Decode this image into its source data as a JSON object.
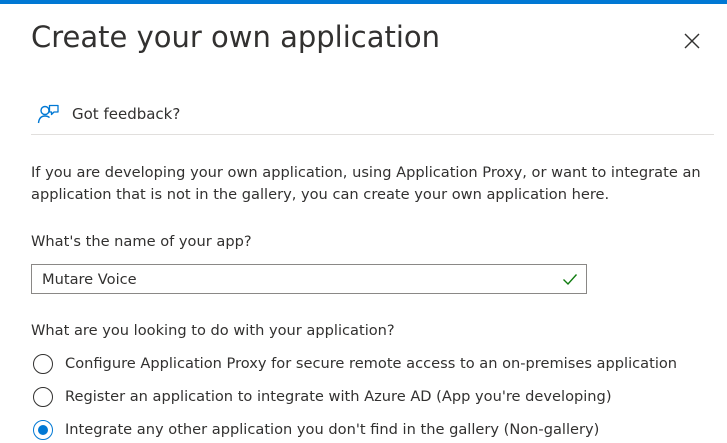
{
  "dialog": {
    "title": "Create your own application",
    "close_icon": "close-icon",
    "accent_color": "#0078d4"
  },
  "feedback": {
    "label": "Got feedback?",
    "icon": "feedback-icon"
  },
  "intro": {
    "text": "If you are developing your own application, using Application Proxy, or want to integrate an application that is not in the gallery, you can create your own application here."
  },
  "app_name": {
    "label": "What's the name of your app?",
    "value": "Mutare Voice",
    "status_icon": "checkmark-icon",
    "valid_color": "#107c10"
  },
  "purpose": {
    "question": "What are you looking to do with your application?",
    "options": [
      {
        "label": "Configure Application Proxy for secure remote access to an on-premises application",
        "selected": false
      },
      {
        "label": "Register an application to integrate with Azure AD (App you're developing)",
        "selected": false
      },
      {
        "label": "Integrate any other application you don't find in the gallery (Non-gallery)",
        "selected": true
      }
    ]
  }
}
